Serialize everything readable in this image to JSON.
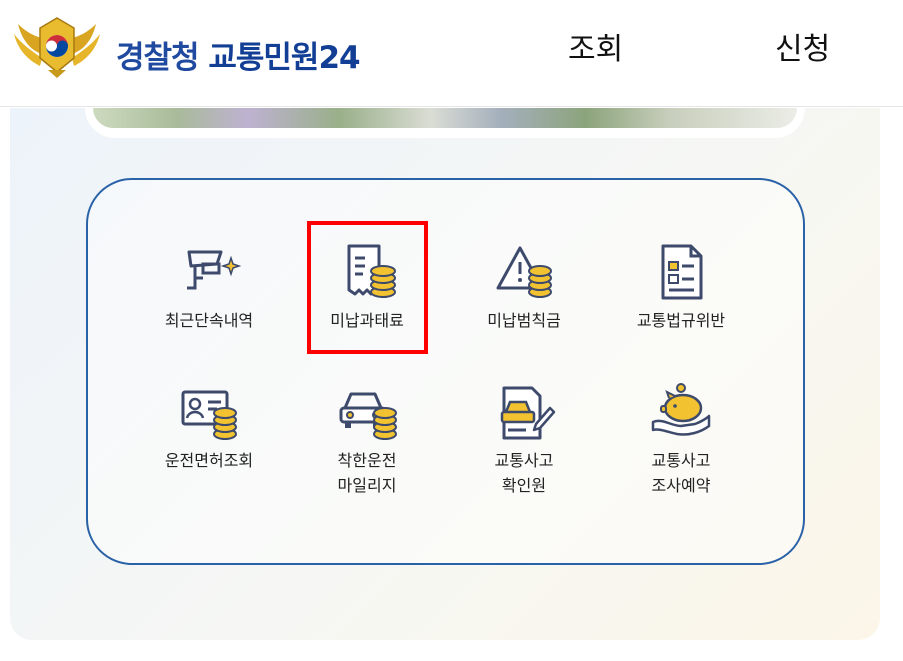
{
  "header": {
    "brand_main": "경찰청",
    "brand_sub": "교통민원24",
    "nav": [
      {
        "label": "조회"
      },
      {
        "label": "신청"
      }
    ]
  },
  "menu": {
    "items": [
      {
        "label_line1": "최근단속내역",
        "label_line2": "",
        "icon": "cctv-camera-icon"
      },
      {
        "label_line1": "미납과태료",
        "label_line2": "",
        "icon": "receipt-coins-icon"
      },
      {
        "label_line1": "미납범칙금",
        "label_line2": "",
        "icon": "warning-coins-icon"
      },
      {
        "label_line1": "교통법규위반",
        "label_line2": "",
        "icon": "document-checklist-icon"
      },
      {
        "label_line1": "운전면허조회",
        "label_line2": "",
        "icon": "id-card-coins-icon"
      },
      {
        "label_line1": "착한운전",
        "label_line2": "마일리지",
        "icon": "car-coins-icon"
      },
      {
        "label_line1": "교통사고",
        "label_line2": "확인원",
        "icon": "accident-document-icon"
      },
      {
        "label_line1": "교통사고",
        "label_line2": "조사예약",
        "icon": "piggy-bank-icon"
      }
    ]
  },
  "colors": {
    "brand_blue": "#1f4aa0",
    "icon_navy": "#3d4a6b",
    "coin_gold": "#f2c230",
    "highlight_red": "#ff0000",
    "box_border": "#2a62a8"
  }
}
